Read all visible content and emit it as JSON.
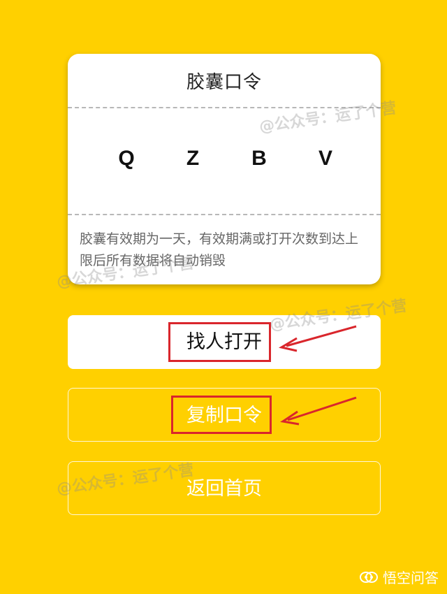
{
  "card": {
    "title": "胶囊口令",
    "code_letters": [
      "Q",
      "Z",
      "B",
      "V"
    ],
    "note": "胶囊有效期为一天，有效期满或打开次数到达上限后所有数据将自动销毁"
  },
  "buttons": {
    "open_label": "找人打开",
    "copy_label": "复制口令",
    "back_label": "返回首页"
  },
  "watermark": "@公众号：运了个营",
  "brand": {
    "label": "悟空问答",
    "icon": "wukong-logo-icon"
  },
  "colors": {
    "background": "#FFD000",
    "highlight": "#D9262C",
    "card": "#FFFFFF"
  }
}
